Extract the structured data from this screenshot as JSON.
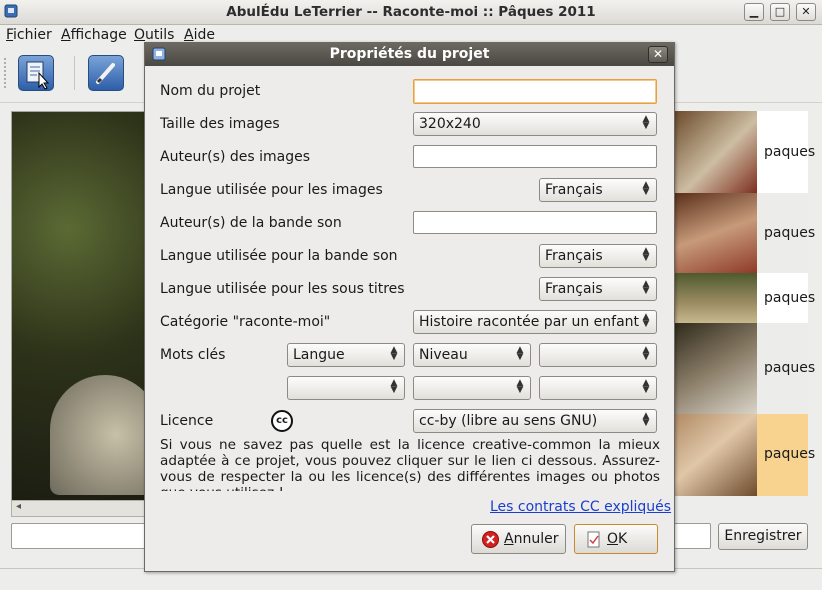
{
  "window": {
    "title": "AbulÉdu LeTerrier -- Raconte-moi :: Pâques 2011"
  },
  "menu": [
    {
      "key": "F",
      "rest": "ichier"
    },
    {
      "key": "A",
      "rest": "ffichage"
    },
    {
      "key": "O",
      "rest": "utils"
    },
    {
      "key": "A",
      "rest": "ide"
    }
  ],
  "list": {
    "label": "paques"
  },
  "main": {
    "save_button": "Enregistrer"
  },
  "dialog": {
    "title": "Propriétés du projet",
    "labels": {
      "name": "Nom du projet",
      "image_size": "Taille des images",
      "image_authors": "Auteur(s) des images",
      "image_lang": "Langue utilisée pour les images",
      "audio_authors": "Auteur(s) de la bande son",
      "audio_lang": "Langue utilisée pour la bande son",
      "subtitle_lang": "Langue utilisée pour les sous titres",
      "category": "Catégorie \"raconte-moi\"",
      "keywords": "Mots clés",
      "license": "Licence"
    },
    "values": {
      "name": "",
      "image_size": "320x240",
      "image_authors": "",
      "image_lang": "Français",
      "audio_authors": "",
      "audio_lang": "Français",
      "subtitle_lang": "Français",
      "category": "Histoire racontée par un enfant",
      "keywords_1": "Langue",
      "keywords_2": "Niveau",
      "keywords_3": "",
      "keywords_4": "",
      "keywords_5": "",
      "keywords_6": "",
      "license": "cc-by (libre au sens GNU)"
    },
    "cc_badge": "cc",
    "info_text": "Si vous ne savez pas quelle est la licence creative-common la mieux adaptée à ce projet, vous pouvez cliquer sur le lien ci dessous. Assurez-vous de respecter la ou les licence(s) des différentes images ou photos que vous utilisez !",
    "cc_link": "Les contrats CC expliqués",
    "cancel_key": "A",
    "cancel_rest": "nnuler",
    "ok_key": "O",
    "ok_rest": "K"
  }
}
